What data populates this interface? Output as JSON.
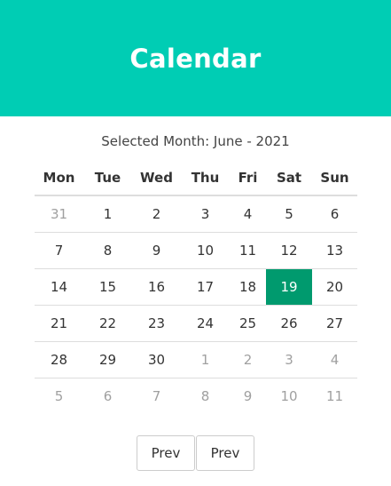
{
  "header": {
    "title": "Calendar"
  },
  "selected_month_text": "Selected Month: June - 2021",
  "weekdays": [
    "Mon",
    "Tue",
    "Wed",
    "Thu",
    "Fri",
    "Sat",
    "Sun"
  ],
  "weeks": [
    [
      {
        "day": "31",
        "muted": true
      },
      {
        "day": "1"
      },
      {
        "day": "2"
      },
      {
        "day": "3"
      },
      {
        "day": "4"
      },
      {
        "day": "5"
      },
      {
        "day": "6"
      }
    ],
    [
      {
        "day": "7"
      },
      {
        "day": "8"
      },
      {
        "day": "9"
      },
      {
        "day": "10"
      },
      {
        "day": "11"
      },
      {
        "day": "12"
      },
      {
        "day": "13"
      }
    ],
    [
      {
        "day": "14"
      },
      {
        "day": "15"
      },
      {
        "day": "16"
      },
      {
        "day": "17"
      },
      {
        "day": "18"
      },
      {
        "day": "19",
        "selected": true
      },
      {
        "day": "20"
      }
    ],
    [
      {
        "day": "21"
      },
      {
        "day": "22"
      },
      {
        "day": "23"
      },
      {
        "day": "24"
      },
      {
        "day": "25"
      },
      {
        "day": "26"
      },
      {
        "day": "27"
      }
    ],
    [
      {
        "day": "28"
      },
      {
        "day": "29"
      },
      {
        "day": "30"
      },
      {
        "day": "1",
        "muted": true
      },
      {
        "day": "2",
        "muted": true
      },
      {
        "day": "3",
        "muted": true
      },
      {
        "day": "4",
        "muted": true
      }
    ],
    [
      {
        "day": "5",
        "muted": true
      },
      {
        "day": "6",
        "muted": true
      },
      {
        "day": "7",
        "muted": true
      },
      {
        "day": "8",
        "muted": true
      },
      {
        "day": "9",
        "muted": true
      },
      {
        "day": "10",
        "muted": true
      },
      {
        "day": "11",
        "muted": true
      }
    ]
  ],
  "buttons": {
    "first_label": "Prev",
    "second_label": "Prev"
  },
  "colors": {
    "header_bg": "#00cdb4",
    "selected_bg": "#009a6e",
    "muted_text": "#a0a0a0"
  }
}
